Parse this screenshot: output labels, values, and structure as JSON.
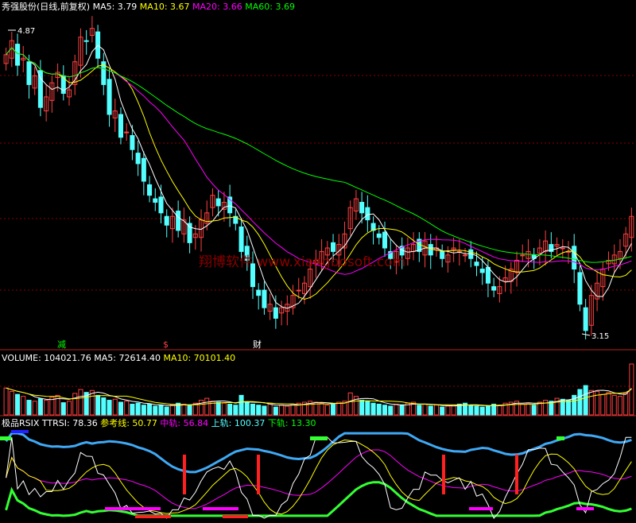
{
  "colors": {
    "background": "#000000",
    "grid": "#8b0000",
    "divider": "#b22222",
    "up": "#ff4040",
    "down": "#54ffff",
    "ma5": "#ffffff",
    "ma10": "#ffff00",
    "ma20": "#ff00ff",
    "ma60": "#00ff00",
    "watermark": "#8b0000"
  },
  "price_panel": {
    "title": "秀强股份(日线,前复权)",
    "indicators": [
      {
        "label": "MA5: 3.79",
        "color": "#ffffff"
      },
      {
        "label": "MA10: 3.67",
        "color": "#ffff00"
      },
      {
        "label": "MA20: 3.66",
        "color": "#ff00ff"
      },
      {
        "label": "MA60: 3.69",
        "color": "#00ff00"
      }
    ],
    "high_label": "4.87",
    "low_label": "3.15",
    "watermark": "翔博软件 www.xiangbosoft.com",
    "event_markers": [
      {
        "text": "减",
        "color": "#00ff00"
      },
      {
        "text": "$",
        "color": "#ff4040"
      },
      {
        "text": "财",
        "color": "#ffffff"
      }
    ]
  },
  "volume_panel": {
    "indicators": [
      {
        "label": "VOLUME: 104021.76",
        "color": "#ffffff"
      },
      {
        "label": "MA5: 72614.40",
        "color": "#ffffff"
      },
      {
        "label": "MA10: 70101.40",
        "color": "#ffff00"
      }
    ]
  },
  "rsi_panel": {
    "indicators": [
      {
        "label": "极品RSIX",
        "color": "#ffffff"
      },
      {
        "label": "TTRSI: 78.36",
        "color": "#ffffff"
      },
      {
        "label": "参考线: 50.77",
        "color": "#ffff00"
      },
      {
        "label": "中轨: 56.84",
        "color": "#ff00ff"
      },
      {
        "label": "上轨: 100.37",
        "color": "#54ffff"
      },
      {
        "label": "下轨: 13.30",
        "color": "#00ff00"
      }
    ]
  },
  "chart_data": {
    "type": "candlestick",
    "title": "秀强股份(日线,前复权)",
    "period": "daily, forward-adjusted",
    "ylim": [
      3.05,
      4.95
    ],
    "high": 4.87,
    "low": 3.15,
    "ma_latest": {
      "MA5": 3.79,
      "MA10": 3.67,
      "MA20": 3.66,
      "MA60": 3.69
    },
    "volume_latest": {
      "VOLUME": 104021.76,
      "MA5": 72614.4,
      "MA10": 70101.4
    },
    "rsix_latest": {
      "TTRSI": 78.36,
      "参考线": 50.77,
      "中轨": 56.84,
      "上轨": 100.37,
      "下轨": 13.3
    },
    "close": [
      4.72,
      4.8,
      4.66,
      4.7,
      4.55,
      4.6,
      4.42,
      4.48,
      4.56,
      4.62,
      4.5,
      4.52,
      4.68,
      4.82,
      4.8,
      4.87,
      4.7,
      4.55,
      4.38,
      4.4,
      4.25,
      4.28,
      4.18,
      4.1,
      4.0,
      3.92,
      3.88,
      3.82,
      3.75,
      3.8,
      3.72,
      3.78,
      3.65,
      3.7,
      3.78,
      3.82,
      3.92,
      3.86,
      3.88,
      3.82,
      3.76,
      3.6,
      3.55,
      3.4,
      3.35,
      3.28,
      3.3,
      3.22,
      3.28,
      3.3,
      3.35,
      3.38,
      3.42,
      3.5,
      3.55,
      3.6,
      3.62,
      3.6,
      3.64,
      3.7,
      3.85,
      3.9,
      3.82,
      3.78,
      3.72,
      3.68,
      3.62,
      3.56,
      3.6,
      3.58,
      3.62,
      3.64,
      3.6,
      3.66,
      3.58,
      3.62,
      3.56,
      3.58,
      3.62,
      3.6,
      3.58,
      3.56,
      3.52,
      3.48,
      3.42,
      3.38,
      3.4,
      3.45,
      3.5,
      3.55,
      3.58,
      3.6,
      3.56,
      3.62,
      3.66,
      3.6,
      3.64,
      3.62,
      3.6,
      3.5,
      3.3,
      3.15,
      3.35,
      3.42,
      3.5,
      3.55,
      3.58,
      3.6,
      3.7,
      3.8
    ],
    "volume": [
      55,
      48,
      42,
      38,
      30,
      28,
      33,
      30,
      36,
      40,
      25,
      28,
      44,
      52,
      46,
      50,
      40,
      35,
      30,
      32,
      26,
      28,
      22,
      24,
      20,
      22,
      18,
      20,
      16,
      20,
      24,
      22,
      20,
      24,
      30,
      34,
      28,
      26,
      24,
      22,
      20,
      40,
      26,
      22,
      20,
      18,
      24,
      16,
      20,
      18,
      22,
      24,
      26,
      28,
      26,
      24,
      20,
      22,
      26,
      28,
      45,
      38,
      30,
      28,
      24,
      22,
      20,
      18,
      22,
      20,
      24,
      26,
      20,
      22,
      18,
      20,
      16,
      18,
      20,
      22,
      24,
      20,
      18,
      16,
      18,
      22,
      20,
      24,
      26,
      28,
      22,
      24,
      20,
      26,
      30,
      28,
      34,
      32,
      30,
      40,
      52,
      60,
      50,
      48,
      42,
      46,
      40,
      38,
      44,
      104
    ]
  }
}
